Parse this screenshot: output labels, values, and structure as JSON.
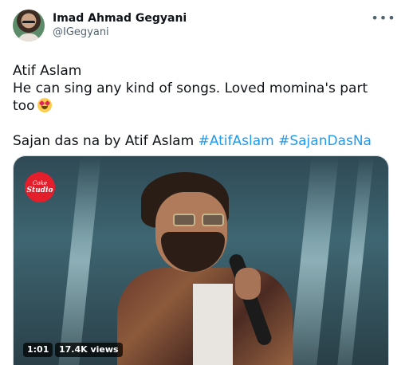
{
  "author": {
    "display_name": "Imad Ahmad Gegyani",
    "handle": "@IGegyani"
  },
  "more_icon": "more-horizontal-icon",
  "tweet": {
    "line1": "Atif Aslam",
    "line2": "He can sing any kind of songs. Loved momina's part",
    "line3": "too",
    "line3_emoji": "heart-eyes-emoji",
    "line4_text": "Sajan das na by Atif Aslam",
    "hashtags": [
      "#AtifAslam",
      "#SajanDasNa"
    ]
  },
  "media": {
    "logo_line1": "Coke",
    "logo_line2": "Studio",
    "duration": "1:01",
    "views": "17.4K views"
  },
  "colors": {
    "link": "#1d9bf0",
    "secondary_text": "#536471",
    "logo_red": "#e41e2b"
  }
}
